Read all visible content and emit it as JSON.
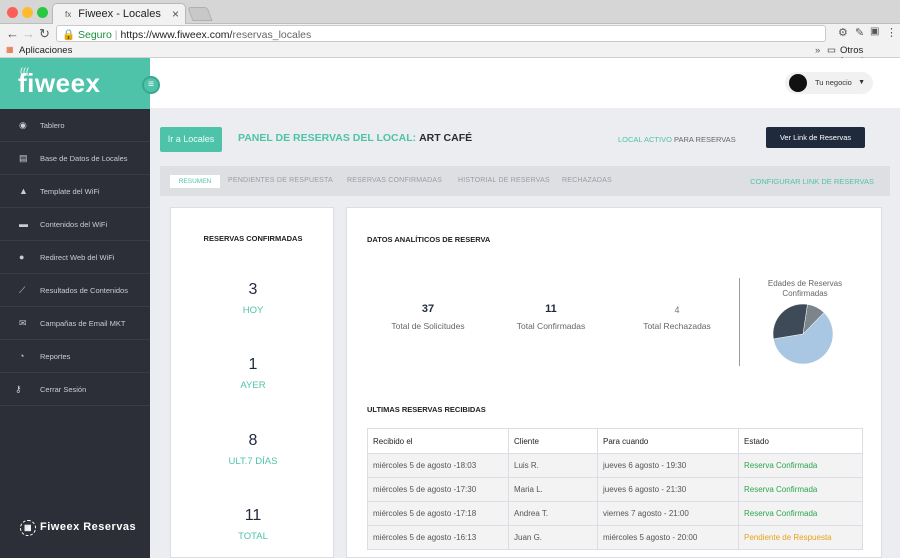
{
  "browser": {
    "tab_title": "Fiweex - Locales",
    "tab_favicon": "fx",
    "secure_label": "Seguro",
    "url_domain": "https://www.fiweex.com/",
    "url_path": "reservas_locales",
    "bookmarks_apps": "Aplicaciones",
    "bookmarks_other": "Otros favoritos"
  },
  "sidebar": {
    "logo": "fiweex",
    "items": [
      {
        "label": "Tablero",
        "icon": "dashboard-icon"
      },
      {
        "label": "Base de Datos de Locales",
        "icon": "database-icon"
      },
      {
        "label": "Template del WiFi",
        "icon": "template-icon"
      },
      {
        "label": "Contenidos del WiFi",
        "icon": "content-icon"
      },
      {
        "label": "Redirect Web del WiFi",
        "icon": "globe-icon"
      },
      {
        "label": "Resultados de Contenidos",
        "icon": "chart-icon"
      },
      {
        "label": "Campañas de Email MKT",
        "icon": "email-icon"
      },
      {
        "label": "Reportes",
        "icon": "reports-icon"
      },
      {
        "label": "Cerrar Sesión",
        "icon": "key-icon"
      }
    ],
    "footer": "Fiweex Reservas"
  },
  "header": {
    "user_label": "Tu negocio"
  },
  "panel": {
    "btn_locales": "Ir a Locales",
    "title_prefix": "PANEL DE RESERVAS DEL LOCAL:",
    "title_local": "ART CAFÉ",
    "status_active": "LOCAL ACTIVO",
    "status_suffix": "PARA RESERVAS",
    "btn_link": "Ver Link de Reservas"
  },
  "tabs": {
    "active": "RESUMEN",
    "items": [
      "PENDIENTES DE RESPUESTA",
      "RESERVAS CONFIRMADAS",
      "HISTORIAL DE RESERVAS",
      "RECHAZADAS"
    ],
    "config": "CONFIGURAR LINK DE RESERVAS"
  },
  "confirmadas": {
    "title": "RESERVAS CONFIRMADAS",
    "stats": [
      {
        "value": "3",
        "label": "HOY"
      },
      {
        "value": "1",
        "label": "AYER"
      },
      {
        "value": "8",
        "label": "ULT.7 DÍAS"
      },
      {
        "value": "11",
        "label": "TOTAL"
      }
    ]
  },
  "analiticos": {
    "title": "DATOS ANALÍTICOS DE RESERVA",
    "metrics": [
      {
        "value": "37",
        "label": "Total de Solicitudes"
      },
      {
        "value": "11",
        "label": "Total Confirmadas"
      },
      {
        "value": "4",
        "label": "Total Rechazadas"
      }
    ],
    "pie_title_1": "Edades de Reservas",
    "pie_title_2": "Confirmadas",
    "pie_slices": [
      {
        "value": 0.1,
        "color": "#7d858c"
      },
      {
        "value": 0.6,
        "color": "#a9c6e3"
      },
      {
        "value": 0.3,
        "color": "#3f4a58"
      }
    ]
  },
  "ultimas": {
    "title": "ULTIMAS RESERVAS RECIBIDAS",
    "columns": [
      "Recibido el",
      "Cliente",
      "Para cuando",
      "Estado"
    ],
    "rows": [
      {
        "recibido": "miércoles 5 de agosto -18:03",
        "cliente": "Luis R.",
        "para": "jueves 6 agosto - 19:30",
        "estado": "Reserva Confirmada",
        "status": "ok"
      },
      {
        "recibido": "miércoles 5 de agosto -17:30",
        "cliente": "Maria L.",
        "para": "jueves 6 agosto - 21:30",
        "estado": "Reserva Confirmada",
        "status": "ok"
      },
      {
        "recibido": "miércoles 5 de agosto -17:18",
        "cliente": "Andrea T.",
        "para": "viernes 7 agosto - 21:00",
        "estado": "Reserva Confirmada",
        "status": "ok"
      },
      {
        "recibido": "miércoles 5 de agosto -16:13",
        "cliente": "Juan G.",
        "para": "miércoles 5 agosto - 20:00",
        "estado": "Pendiente de Respuesta",
        "status": "pend"
      }
    ]
  }
}
